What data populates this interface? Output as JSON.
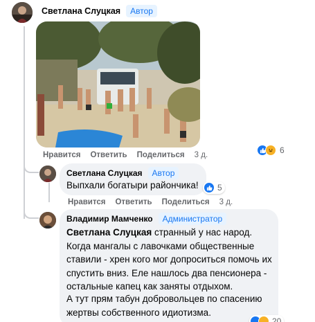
{
  "top_comment": {
    "author": "Светлана Слуцкая",
    "badge": "Автор",
    "actions": {
      "like": "Нравится",
      "reply": "Ответить",
      "share": "Поделиться",
      "time": "3 д."
    },
    "reactions": {
      "count": "6",
      "icons": [
        "like-icon",
        "haha-icon"
      ]
    }
  },
  "reply_1": {
    "author": "Светлана Слуцкая",
    "badge": "Автор",
    "text": "Выпхали богатыри райончика!",
    "reactions": {
      "count": "5",
      "icons": [
        "like-icon"
      ]
    },
    "actions": {
      "like": "Нравится",
      "reply": "Ответить",
      "share": "Поделиться",
      "time": "3 д."
    }
  },
  "reply_2": {
    "author": "Владимир Мамченко",
    "badge": "Администратор",
    "mention": "Светлана Слуцкая",
    "paragraph_1_rest": " странный у нас народ. Когда мангалы с лавочками общественные ставили - хрен кого мог допроситься помочь их спустить вниз. Еле нашлось два пенсионера - остальные капец как заняты отдыхом.",
    "paragraph_2": "А тут прям табун добровольцев по спасению жертвы собственного идиотизма.",
    "reactions": {
      "count": "20"
    }
  },
  "colors": {
    "accent": "#1877f2",
    "bubble": "#f0f2f5",
    "muted": "#65676b",
    "badge_bg": "#e7f3ff"
  }
}
